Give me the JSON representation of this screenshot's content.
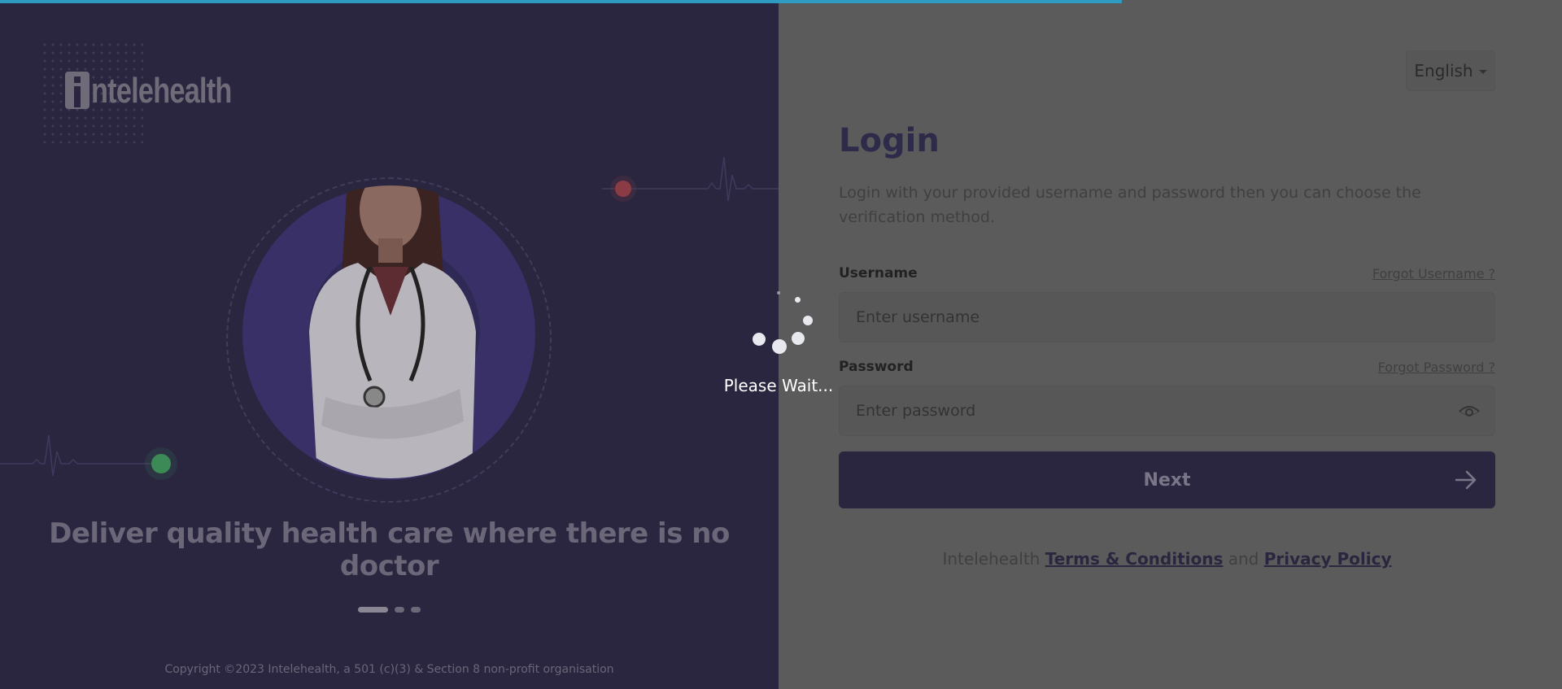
{
  "progress": {
    "percent": 71.8,
    "color": "#2e9cc0"
  },
  "brand": {
    "logo_text": "ntelehealth"
  },
  "hero": {
    "tagline": "Deliver quality health care where there is no doctor",
    "slides": 3,
    "active_slide": 1
  },
  "copyright": "Copyright ©2023 Intelehealth, a 501 (c)(3) & Section 8 non-profit organisation",
  "language": {
    "selected": "English"
  },
  "login": {
    "title": "Login",
    "subtitle": "Login with your provided username and password then you can choose the verification method.",
    "username": {
      "label": "Username",
      "placeholder": "Enter username",
      "forgot": "Forgot Username ?"
    },
    "password": {
      "label": "Password",
      "placeholder": "Enter password",
      "forgot": "Forgot Password ?"
    },
    "next_label": "Next"
  },
  "footer": {
    "prefix": "Intelehealth",
    "terms": "Terms & Conditions",
    "and": "and",
    "privacy": "Privacy Policy"
  },
  "loading": {
    "text": "Please Wait..."
  },
  "colors": {
    "panel_dark": "#2a2640",
    "overlay": "#5b5b5b",
    "accent": "#2e9cc0"
  }
}
